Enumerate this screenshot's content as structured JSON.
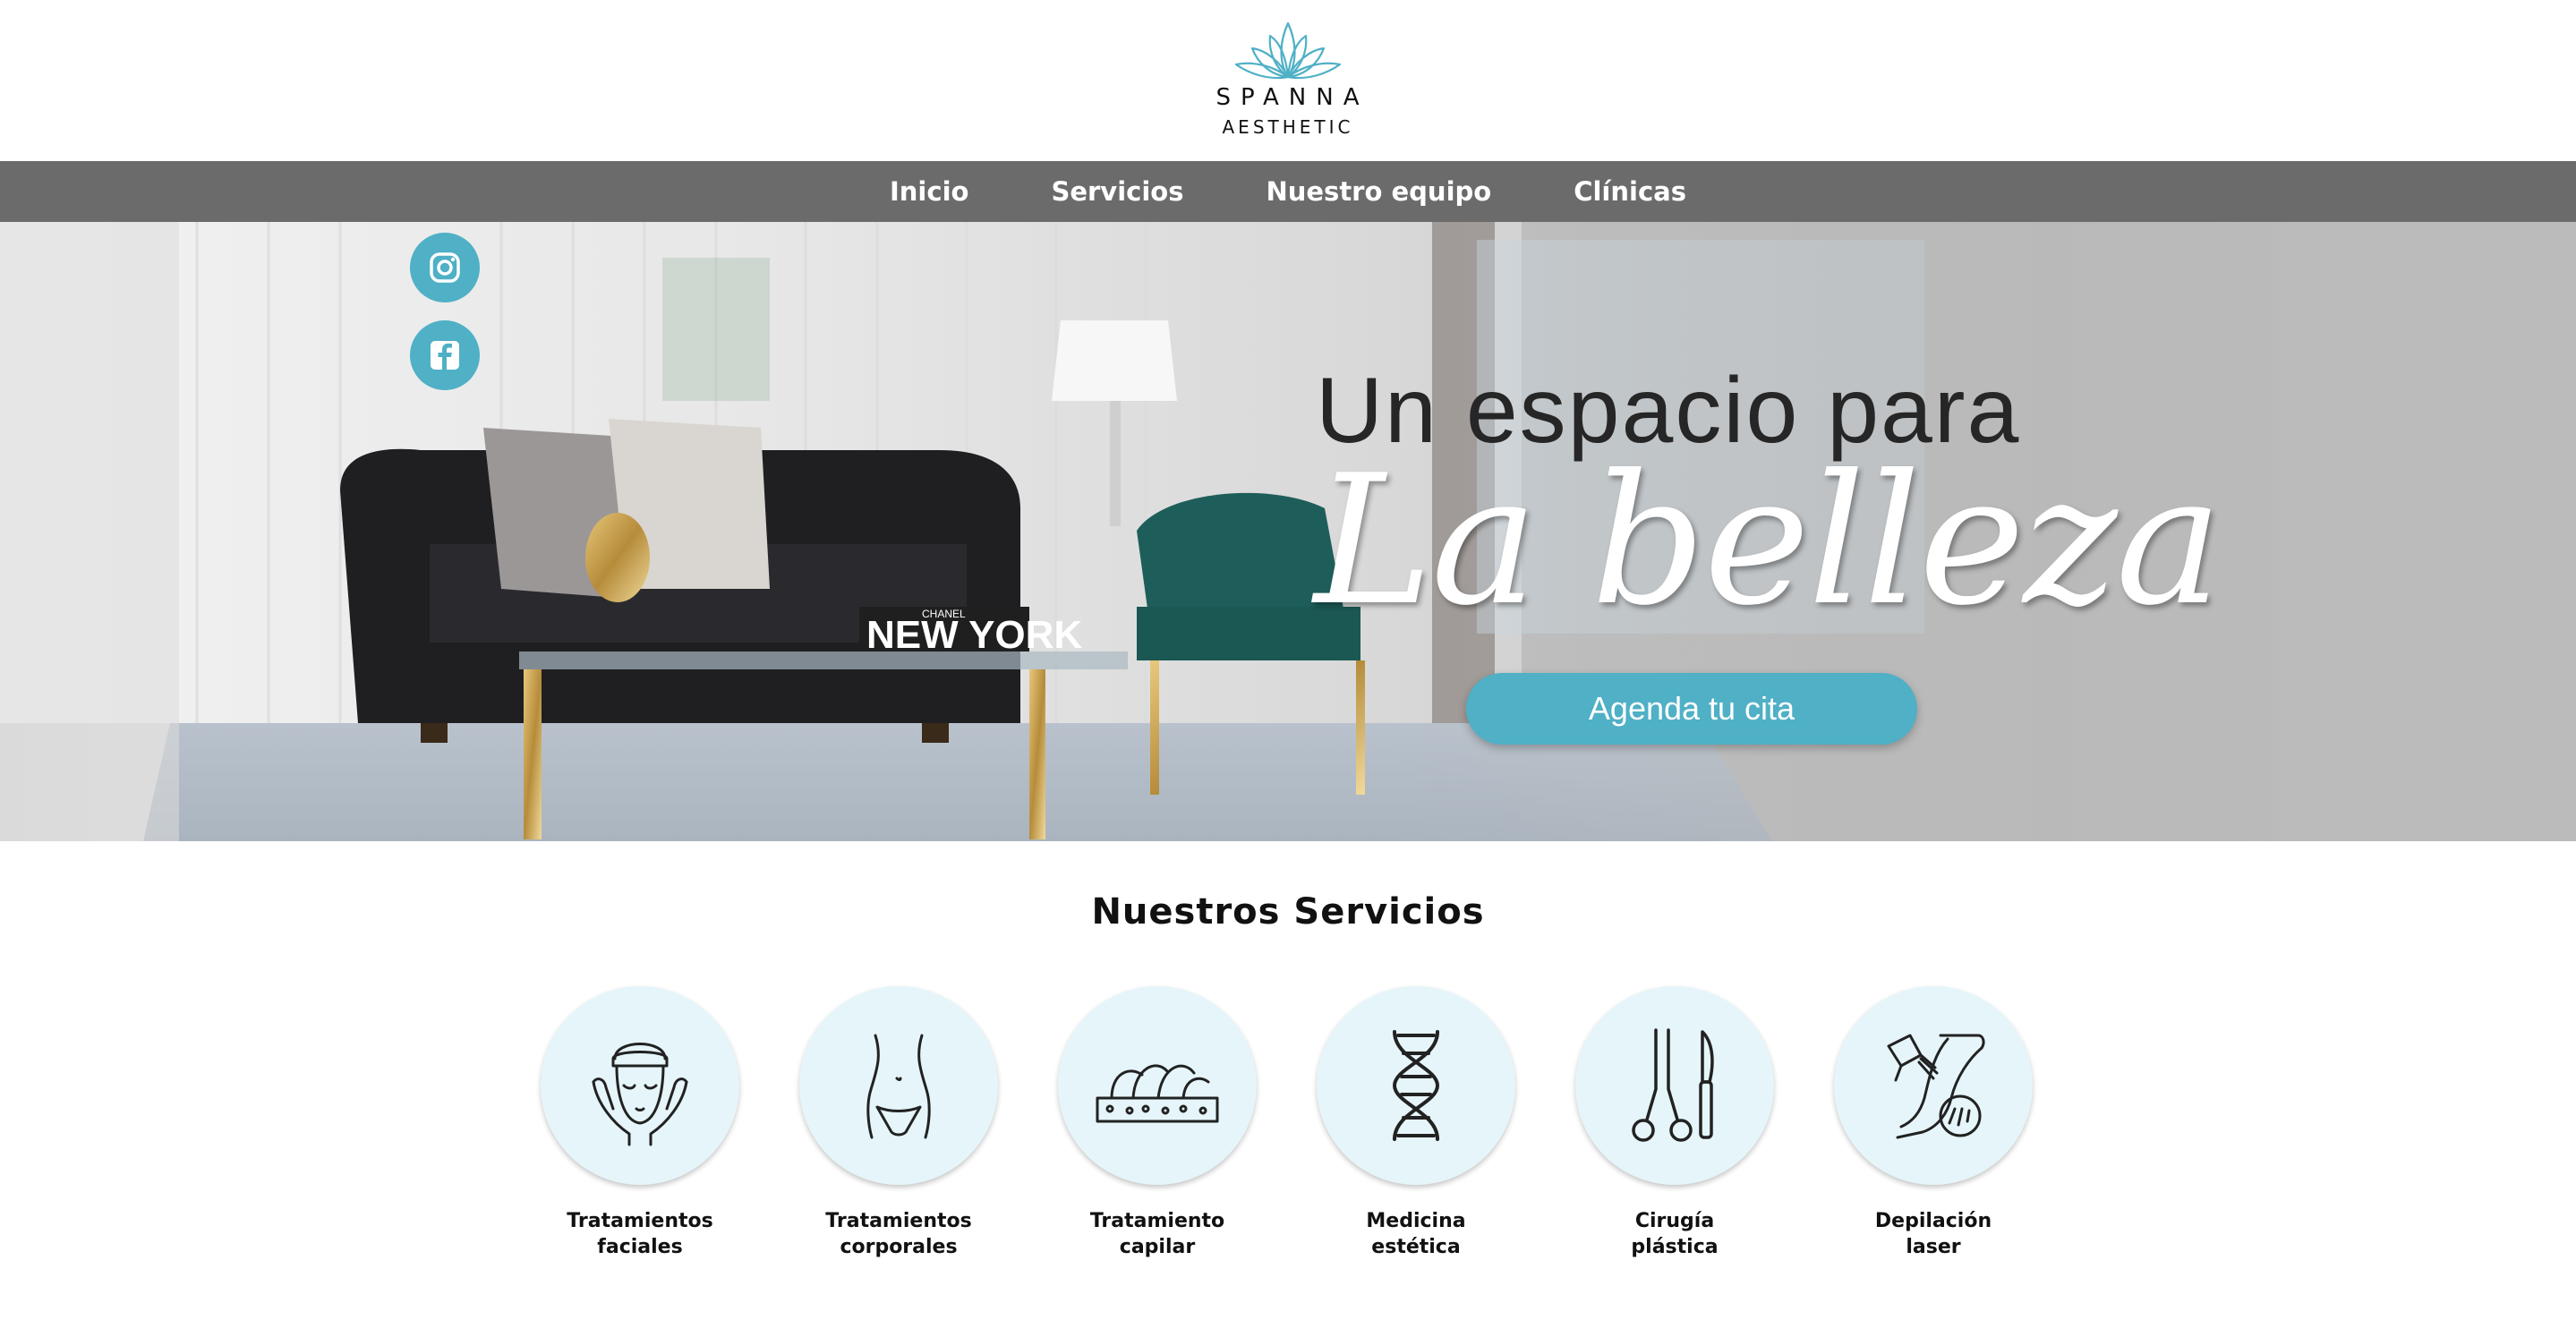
{
  "brand": {
    "name": "SPANNA",
    "subtitle": "AESTHETIC",
    "accent_color": "#4fb0c6",
    "nav_color": "#6b6b6b"
  },
  "nav": {
    "items": [
      {
        "label": "Inicio"
      },
      {
        "label": "Servicios"
      },
      {
        "label": "Nuestro equipo"
      },
      {
        "label": "Clínicas"
      }
    ]
  },
  "social": {
    "instagram_icon": "instagram-icon",
    "facebook_icon": "facebook-icon"
  },
  "hero": {
    "line1": "Un espacio para",
    "line2": "La belleza",
    "sign_text_1": "CHANEL",
    "sign_text_2": "NEW YORK",
    "cta_label": "Agenda tu cita"
  },
  "services": {
    "title": "Nuestros Servicios",
    "items": [
      {
        "line1": "Tratamientos",
        "line2": "faciales",
        "icon": "face-treatment-icon"
      },
      {
        "line1": "Tratamientos",
        "line2": "corporales",
        "icon": "body-treatment-icon"
      },
      {
        "line1": "Tratamiento",
        "line2": "capilar",
        "icon": "hair-treatment-icon"
      },
      {
        "line1": "Medicina",
        "line2": "estética",
        "icon": "dna-icon"
      },
      {
        "line1": "Cirugía",
        "line2": "plástica",
        "icon": "surgery-tools-icon"
      },
      {
        "line1": "Depilación",
        "line2": "laser",
        "icon": "laser-hair-removal-icon"
      }
    ]
  }
}
